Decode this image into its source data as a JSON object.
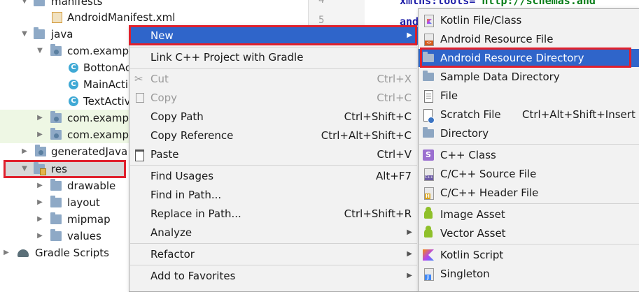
{
  "tree": {
    "rows": [
      {
        "label": "manifests",
        "kind": "folder"
      },
      {
        "label": "AndroidManifest.xml",
        "kind": "xml"
      },
      {
        "label": "java",
        "kind": "folder"
      },
      {
        "label": "com.exampl",
        "kind": "package"
      },
      {
        "label": "BottonAc",
        "kind": "class"
      },
      {
        "label": "MainActi",
        "kind": "class"
      },
      {
        "label": "TextActiv",
        "kind": "class"
      },
      {
        "label": "com.exampl",
        "kind": "package"
      },
      {
        "label": "com.exampl",
        "kind": "package"
      },
      {
        "label": "generatedJava",
        "kind": "generated"
      },
      {
        "label": "res",
        "kind": "res"
      },
      {
        "label": "drawable",
        "kind": "folder"
      },
      {
        "label": "layout",
        "kind": "folder"
      },
      {
        "label": "mipmap",
        "kind": "folder"
      },
      {
        "label": "values",
        "kind": "folder"
      },
      {
        "label": "Gradle Scripts",
        "kind": "gradle"
      }
    ],
    "class_badge": "C",
    "collapsed_arrow": "▶",
    "expanded_arrow": "▼"
  },
  "gutter": {
    "line_numbers": [
      "4",
      "5"
    ]
  },
  "editor": {
    "line1_attr": "xmlns:tools=",
    "line1_val": "\"http://schemas.and",
    "line2_attr": "and"
  },
  "context_menu": {
    "submenu_arrow": "▶",
    "items": [
      {
        "label": "New",
        "shortcut": "",
        "submenu": true,
        "selected": true
      },
      {
        "label": "Link C++ Project with Gradle",
        "shortcut": ""
      },
      {
        "label": "Cut",
        "shortcut": "Ctrl+X",
        "disabled": true
      },
      {
        "label": "Copy",
        "shortcut": "Ctrl+C",
        "disabled": true
      },
      {
        "label": "Copy Path",
        "shortcut": "Ctrl+Shift+C"
      },
      {
        "label": "Copy Reference",
        "shortcut": "Ctrl+Alt+Shift+C"
      },
      {
        "label": "Paste",
        "shortcut": "Ctrl+V"
      },
      {
        "label": "Find Usages",
        "shortcut": "Alt+F7"
      },
      {
        "label": "Find in Path...",
        "shortcut": ""
      },
      {
        "label": "Replace in Path...",
        "shortcut": "Ctrl+Shift+R"
      },
      {
        "label": "Analyze",
        "shortcut": "",
        "submenu": true
      },
      {
        "label": "Refactor",
        "shortcut": "",
        "submenu": true
      },
      {
        "label": "Add to Favorites",
        "shortcut": "",
        "submenu": true
      }
    ]
  },
  "new_submenu": {
    "items": [
      {
        "label": "Kotlin File/Class",
        "icon": "kotlin-file-icon"
      },
      {
        "label": "Android Resource File",
        "icon": "android-resource-file-icon"
      },
      {
        "label": "Android Resource Directory",
        "icon": "folder-icon",
        "selected": true
      },
      {
        "label": "Sample Data Directory",
        "icon": "folder-icon"
      },
      {
        "label": "File",
        "icon": "file-icon"
      },
      {
        "label": "Scratch File",
        "icon": "scratch-file-icon",
        "shortcut": "Ctrl+Alt+Shift+Insert"
      },
      {
        "label": "Directory",
        "icon": "folder-icon"
      },
      {
        "label": "C++ Class",
        "icon": "cpp-class-icon",
        "badge": "S"
      },
      {
        "label": "C/C++ Source File",
        "icon": "cpp-source-file-icon"
      },
      {
        "label": "C/C++ Header File",
        "icon": "cpp-header-file-icon"
      },
      {
        "label": "Image Asset",
        "icon": "android-icon"
      },
      {
        "label": "Vector Asset",
        "icon": "android-icon"
      },
      {
        "label": "Kotlin Script",
        "icon": "kotlin-icon"
      },
      {
        "label": "Singleton",
        "icon": "singleton-icon"
      }
    ]
  },
  "colors": {
    "selection": "#2f65ca",
    "highlight_outline": "#e0202c",
    "menu_background": "#f2f2f2",
    "folder": "#8ea9c6",
    "class_badge": "#3fa9d5"
  }
}
